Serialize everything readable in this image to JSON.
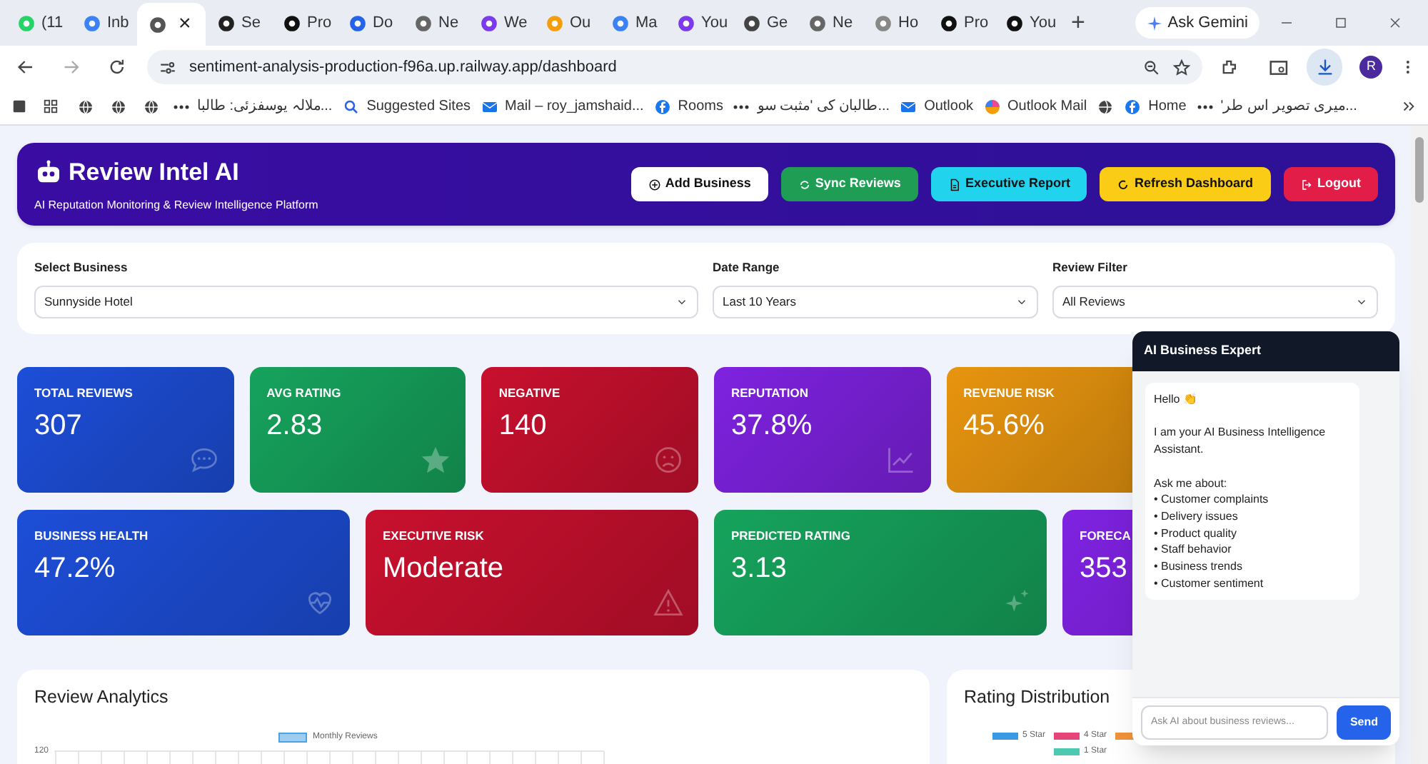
{
  "browser": {
    "tabs": [
      {
        "label": "(11",
        "selected": false
      },
      {
        "label": "Inb",
        "selected": false
      },
      {
        "selected": true
      },
      {
        "label": "Se",
        "selected": false
      },
      {
        "label": "Pro",
        "selected": false
      },
      {
        "label": "Do",
        "selected": false
      },
      {
        "label": "Ne",
        "selected": false
      },
      {
        "label": "We",
        "selected": false
      },
      {
        "label": "Ou",
        "selected": false
      },
      {
        "label": "Ma",
        "selected": false
      },
      {
        "label": "You",
        "selected": false
      },
      {
        "label": "Ge",
        "selected": false
      },
      {
        "label": "Ne",
        "selected": false
      },
      {
        "label": "Ho",
        "selected": false
      },
      {
        "label": "Pro",
        "selected": false
      },
      {
        "label": "You",
        "selected": false
      }
    ],
    "close_tab": "×",
    "new_tab": "+",
    "gemini": "Ask Gemini",
    "address": "sentiment-analysis-production-f96a.up.railway.app/dashboard",
    "profile": "R",
    "bookmarks": [
      {
        "label": "ملالہ یوسفزئی: طالبا..."
      },
      {
        "label": "Suggested Sites"
      },
      {
        "label": "Mail – roy_jamshaid..."
      },
      {
        "label": "Rooms"
      },
      {
        "label": "طالبان کی 'مثبت سو..."
      },
      {
        "label": "Outlook"
      },
      {
        "label": "Outlook Mail"
      },
      {
        "label": "Home"
      },
      {
        "label": "'میری تصویر اس طر..."
      }
    ]
  },
  "header": {
    "title": "Review Intel AI",
    "subtitle": "AI Reputation Monitoring & Review Intelligence Platform",
    "buttons": [
      {
        "label": "Add Business",
        "color": "#ffffff"
      },
      {
        "label": "Sync Reviews",
        "color": "#1f9d55"
      },
      {
        "label": "Executive Report",
        "color": "#22d3ee"
      },
      {
        "label": "Refresh Dashboard",
        "color": "#facc15"
      },
      {
        "label": "Logout",
        "color": "#e11d48"
      }
    ]
  },
  "filters": [
    {
      "label": "Select Business",
      "value": "Sunnyside Hotel"
    },
    {
      "label": "Date Range",
      "value": "Last 10 Years"
    },
    {
      "label": "Review Filter",
      "value": "All Reviews"
    }
  ],
  "stats_row_1": [
    {
      "label": "TOTAL REVIEWS",
      "value": "307",
      "color": "#1d4ed8"
    },
    {
      "label": "AVG RATING",
      "value": "2.83",
      "color": "#16a35c"
    },
    {
      "label": "NEGATIVE",
      "value": "140",
      "color": "#c8102e"
    },
    {
      "label": "REPUTATION",
      "value": "37.8%",
      "color": "#7e22e0"
    },
    {
      "label": "REVENUE RISK",
      "value": "45.6%",
      "color": "#e8950f"
    }
  ],
  "stats_row_2": [
    {
      "label": "BUSINESS HEALTH",
      "value": "47.2%",
      "color": "#1d4ed8"
    },
    {
      "label": "EXECUTIVE RISK",
      "value": "Moderate",
      "color": "#c8102e"
    },
    {
      "label": "PREDICTED RATING",
      "value": "3.13",
      "color": "#16a35c"
    },
    {
      "label": "FORECA",
      "value": "353",
      "color": "#7e22e0"
    }
  ],
  "review_analytics": {
    "title": "Review Analytics",
    "legend": "Monthly Reviews",
    "y_tick": "120"
  },
  "rating_distribution": {
    "title": "Rating Distribution",
    "legend": [
      {
        "label": "5 Star",
        "color": "#3b9ae1"
      },
      {
        "label": "4 Star",
        "color": "#e6457a"
      },
      {
        "color": "#f0933a"
      },
      {
        "label": "1 Star",
        "color": "#4cc9b0"
      }
    ]
  },
  "chat": {
    "title": "AI Business Expert",
    "message": "Hello 👏\n\nI am your AI Business Intelligence Assistant.\n\nAsk me about:\n• Customer complaints\n• Delivery issues\n• Product quality\n• Staff behavior\n• Business trends\n• Customer sentiment",
    "placeholder": "Ask AI about business reviews...",
    "send": "Send"
  }
}
